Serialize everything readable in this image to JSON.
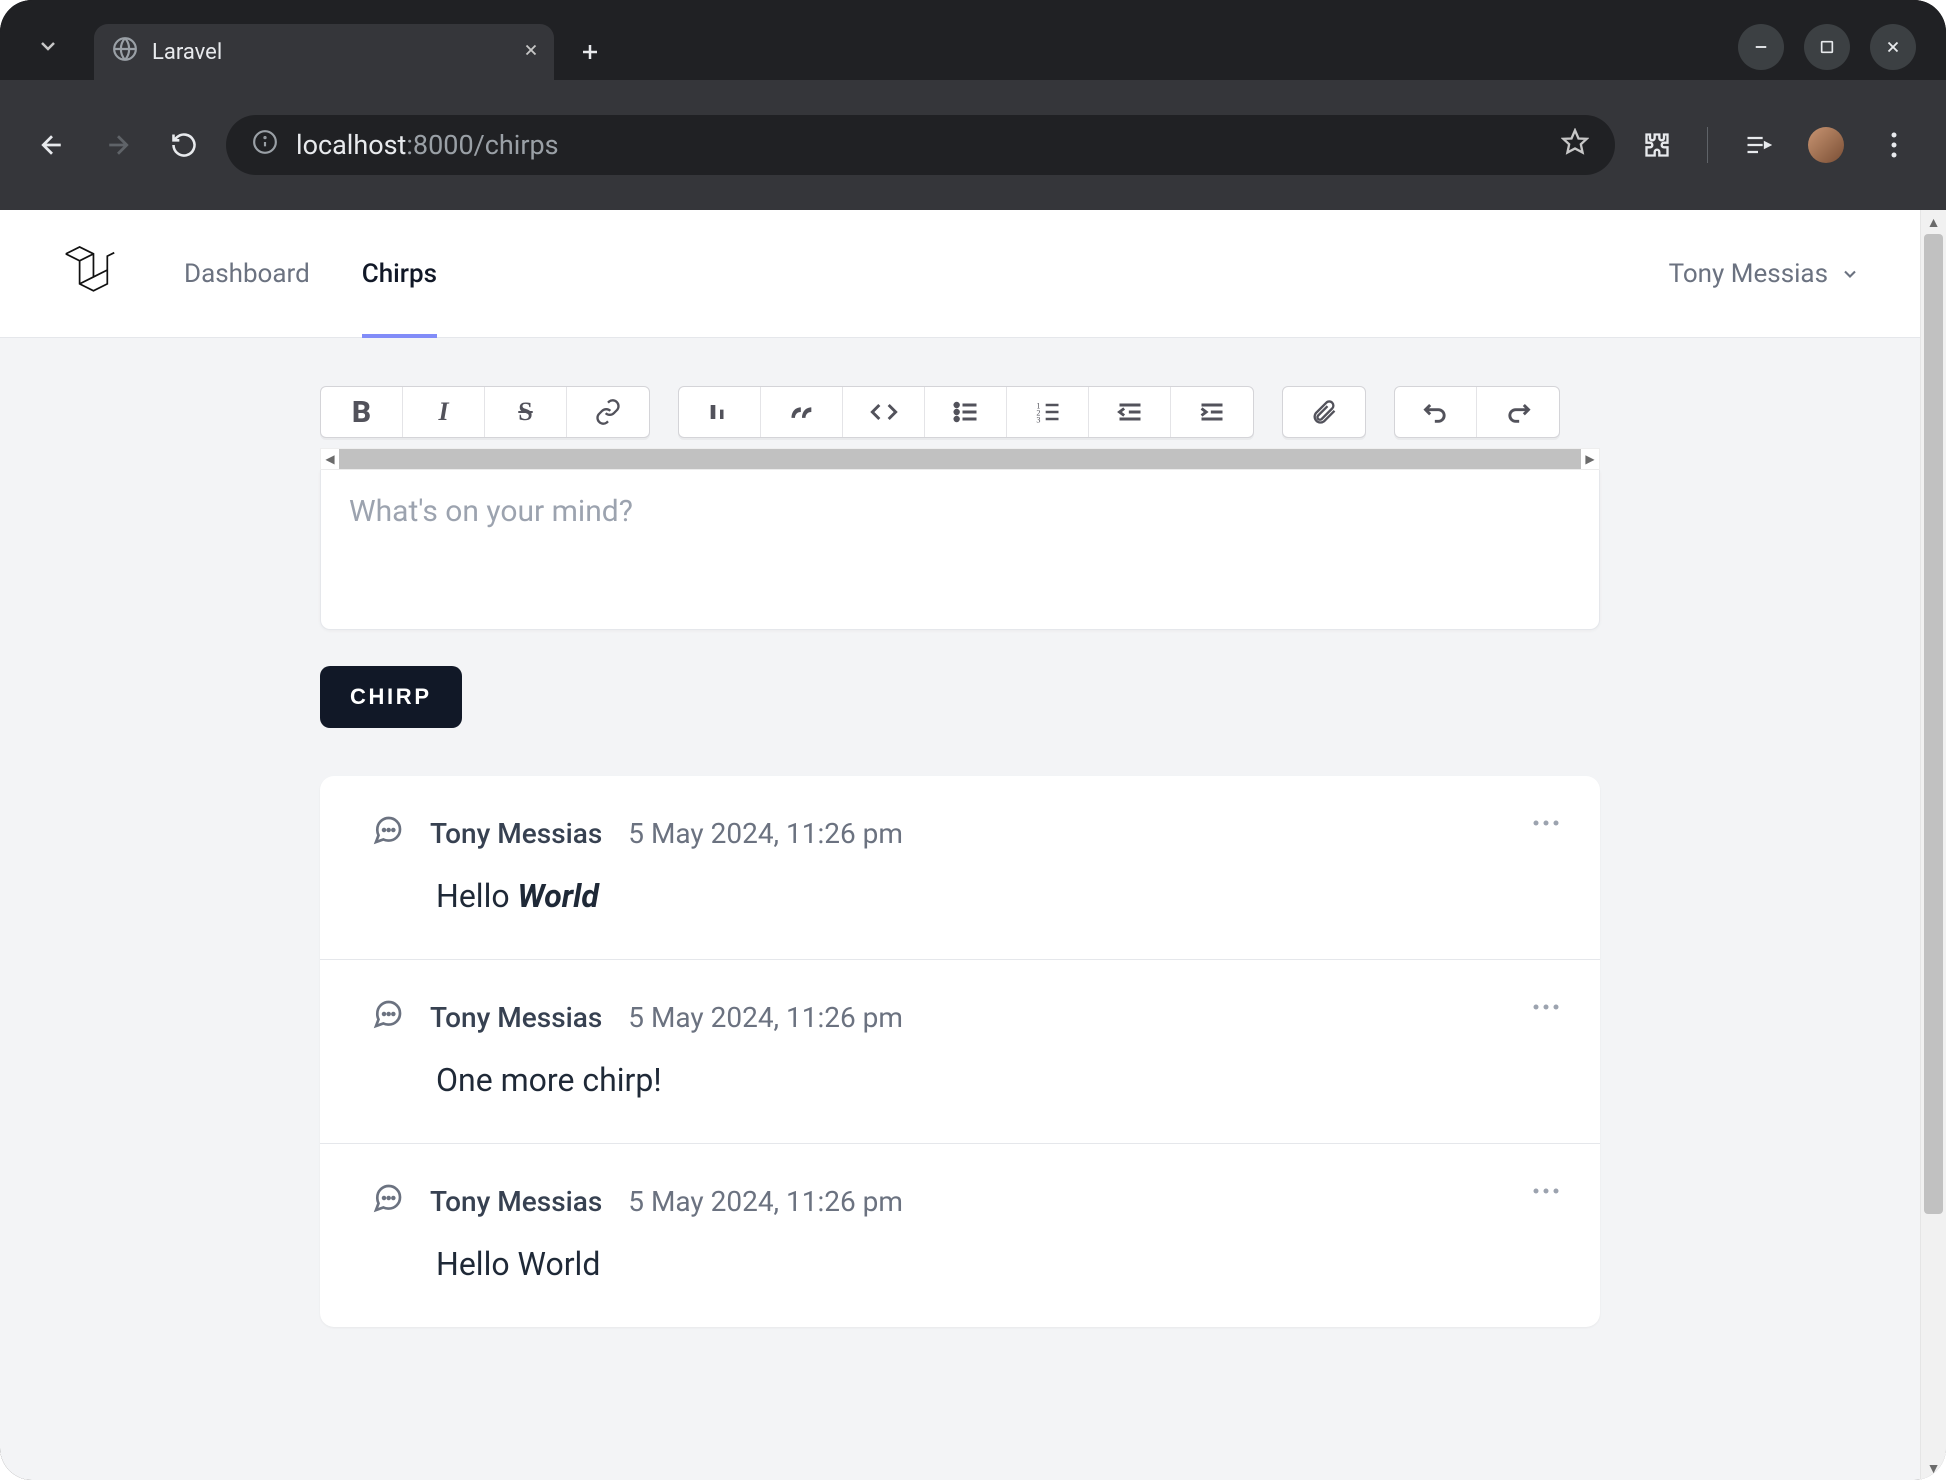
{
  "browser": {
    "tab_title": "Laravel",
    "url_host": "localhost",
    "url_port_path": ":8000/chirps"
  },
  "app": {
    "nav": {
      "dashboard": "Dashboard",
      "chirps": "Chirps"
    },
    "user_name": "Tony Messias"
  },
  "editor": {
    "placeholder": "What's on your mind?",
    "toolbar": {
      "bold": "B",
      "italic": "I",
      "strike": "S"
    },
    "submit_label": "CHIRP"
  },
  "chirps": [
    {
      "author": "Tony Messias",
      "timestamp": "5 May 2024, 11:26 pm",
      "body_prefix": "Hello ",
      "body_em": "World",
      "body_suffix": ""
    },
    {
      "author": "Tony Messias",
      "timestamp": "5 May 2024, 11:26 pm",
      "body_prefix": "One more chirp!",
      "body_em": "",
      "body_suffix": ""
    },
    {
      "author": "Tony Messias",
      "timestamp": "5 May 2024, 11:26 pm",
      "body_prefix": "Hello World",
      "body_em": "",
      "body_suffix": ""
    }
  ]
}
